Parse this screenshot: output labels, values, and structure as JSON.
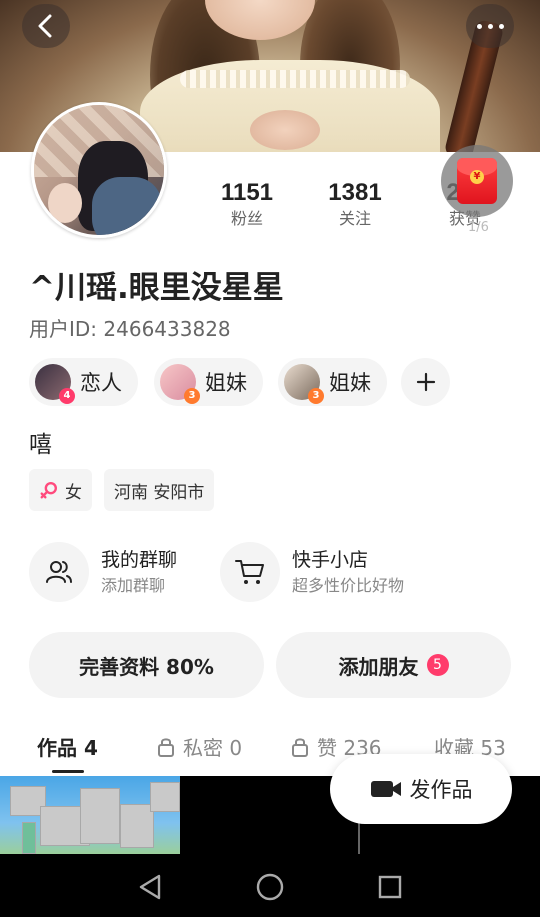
{
  "header": {
    "back_icon": "chevron-left-icon",
    "more_icon": "more-dots-icon"
  },
  "red_packet": {
    "icon": "red-envelope-icon",
    "count": "1/6"
  },
  "stats": {
    "fans": {
      "value": "1151",
      "label": "粉丝"
    },
    "following": {
      "value": "1381",
      "label": "关注"
    },
    "likes": {
      "value": "2…",
      "label": "获赞"
    }
  },
  "profile": {
    "username": "^川瑶.眼里没星星",
    "user_id": "用户ID: 2466433828",
    "bio": "嘻"
  },
  "relations": [
    {
      "label": "恋人",
      "badge": "4",
      "badge_color": "#ff3b6b"
    },
    {
      "label": "姐妹",
      "badge": "3",
      "badge_color": "#ff7a2e"
    },
    {
      "label": "姐妹",
      "badge": "3",
      "badge_color": "#ff7a2e"
    }
  ],
  "tags": {
    "gender": "女",
    "location": "河南 安阳市"
  },
  "entries": {
    "group": {
      "title": "我的群聊",
      "subtitle": "添加群聊"
    },
    "shop": {
      "title": "快手小店",
      "subtitle": "超多性价比好物"
    }
  },
  "buttons": {
    "complete_profile": "完善资料 80%",
    "add_friends": "添加朋友",
    "add_friends_count": "5"
  },
  "tabs": {
    "works": "作品 4",
    "private": "私密 0",
    "liked": "赞 236",
    "favorites": "收藏 53"
  },
  "post_button": "发作品",
  "colors": {
    "accent": "#ff3b6b",
    "badge_orange": "#ff7a2e",
    "chip_bg": "#f4f4f4"
  }
}
